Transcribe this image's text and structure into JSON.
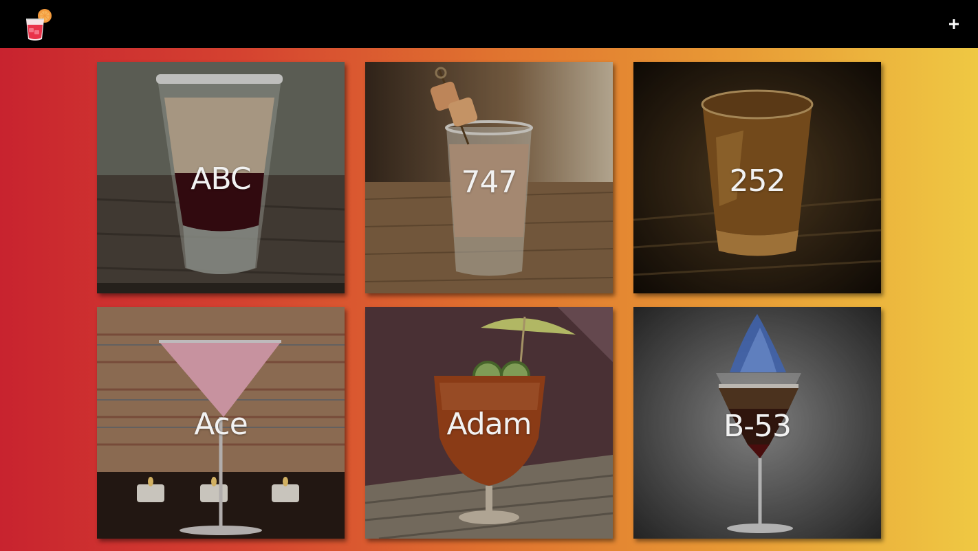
{
  "header": {
    "logo_icon": "cocktail-glass-icon",
    "add_icon": "plus-icon"
  },
  "cocktails": [
    {
      "name": "ABC"
    },
    {
      "name": "747"
    },
    {
      "name": "252"
    },
    {
      "name": "Ace"
    },
    {
      "name": "Adam"
    },
    {
      "name": "B-53"
    }
  ],
  "colors": {
    "header_bg": "#000000",
    "gradient_start": "#c8232f",
    "gradient_end": "#efc843",
    "card_text": "#f2f2f2"
  }
}
